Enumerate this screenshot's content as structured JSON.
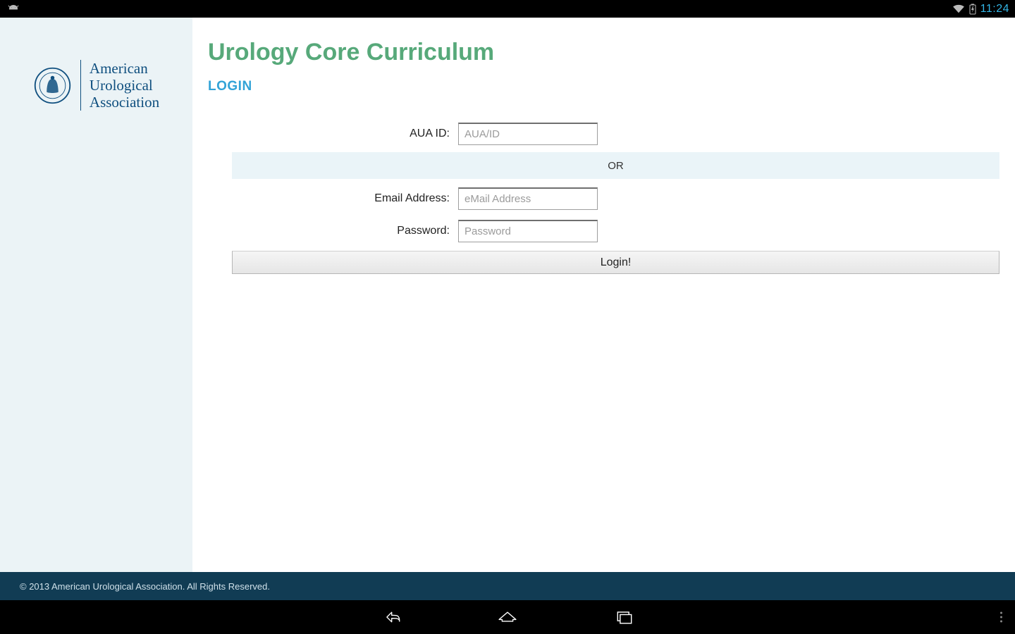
{
  "statusbar": {
    "time": "11:24"
  },
  "sidebar": {
    "org_line1": "American",
    "org_line2": "Urological",
    "org_line3": "Association"
  },
  "main": {
    "title": "Urology Core Curriculum",
    "login_heading": "LOGIN",
    "aua_label": "AUA ID:",
    "aua_placeholder": "AUA/ID",
    "or_text": "OR",
    "email_label": "Email Address:",
    "email_placeholder": "eMail Address",
    "password_label": "Password:",
    "password_placeholder": "Password",
    "login_button": "Login!"
  },
  "footer": {
    "copyright": "© 2013 American Urological Association. All Rights Reserved."
  }
}
